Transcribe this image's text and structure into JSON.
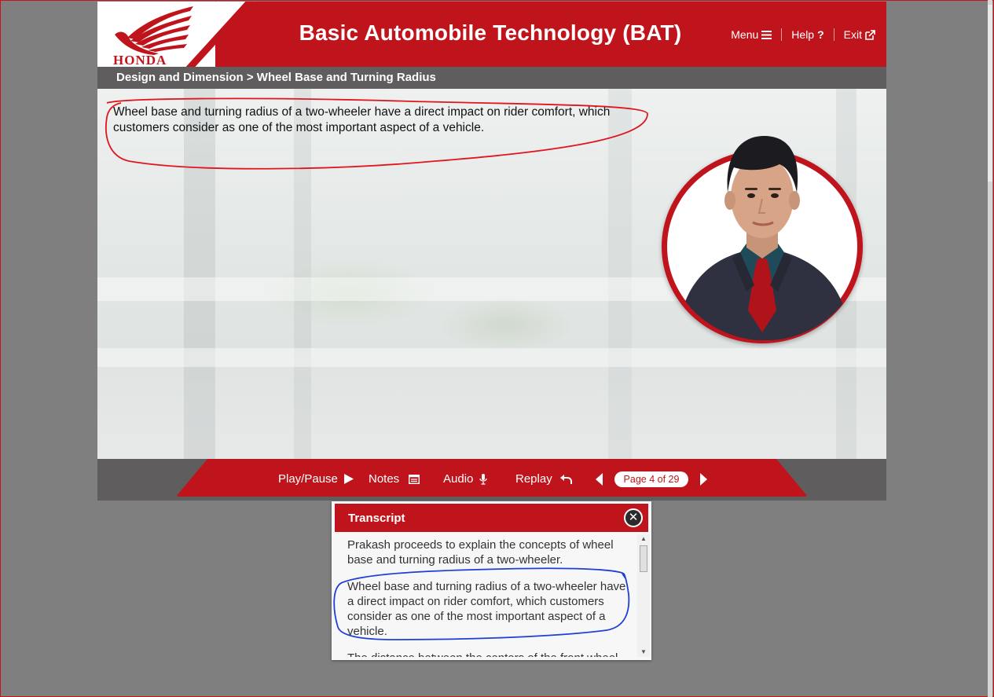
{
  "header": {
    "logo_text": "HONDA",
    "title": "Basic Automobile Technology (BAT)",
    "nav": [
      {
        "label": "Menu",
        "icon": "hamburger-icon"
      },
      {
        "label": "Help",
        "icon": "question-icon"
      },
      {
        "label": "Exit",
        "icon": "external-link-icon"
      }
    ]
  },
  "breadcrumb": "Design and Dimension > Wheel Base and Turning Radius",
  "stage": {
    "text": "Wheel base and turning radius of a two-wheeler have a direct impact on rider comfort, which customers consider as one of the most important aspect of a vehicle."
  },
  "controls": {
    "play_pause": "Play/Pause",
    "notes": "Notes",
    "audio": "Audio",
    "replay": "Replay",
    "page_indicator": "Page 4 of 29"
  },
  "transcript": {
    "title": "Transcript",
    "paragraphs": [
      "Prakash proceeds to explain the concepts of wheel base and turning radius of a two-wheeler.",
      "Wheel base and turning radius of a two-wheeler have a direct impact on rider comfort, which customers consider as one of the most important aspect of a vehicle.",
      "The distance between the centers of the front wheel"
    ]
  },
  "colors": {
    "brand_red": "#c0141c",
    "bar_gray": "#5f5d5e",
    "annotation_red": "#e0161e",
    "annotation_blue": "#1f3fd6"
  }
}
